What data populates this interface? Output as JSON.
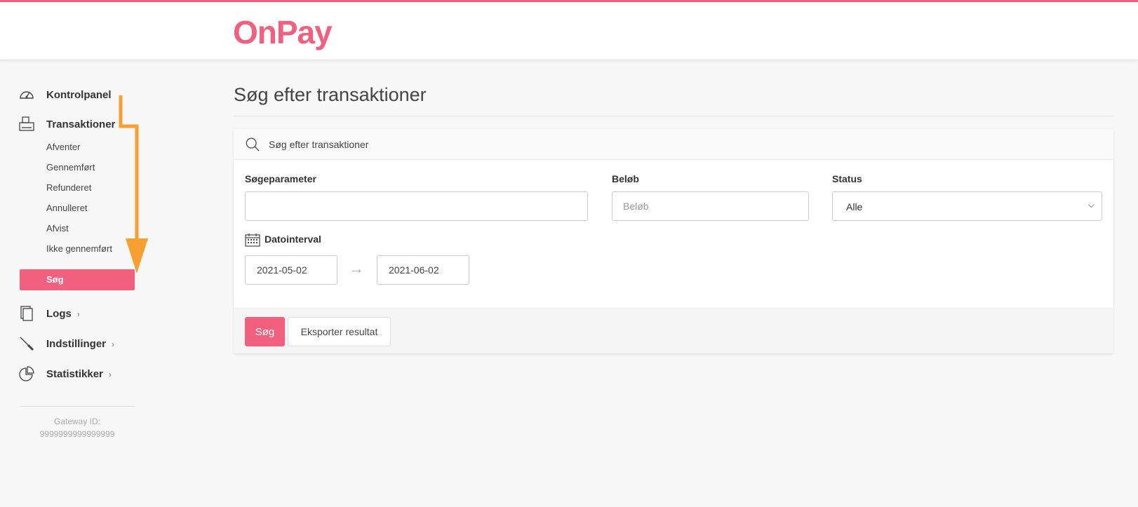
{
  "brand": {
    "logo_text": "OnPay",
    "accent_color": "#f2607f"
  },
  "sidebar": {
    "main_items": [
      {
        "label": "Kontrolpanel",
        "icon": "gauge-icon"
      },
      {
        "label": "Transaktioner",
        "icon": "printer-icon"
      }
    ],
    "sub_items": [
      {
        "label": "Afventer"
      },
      {
        "label": "Gennemført"
      },
      {
        "label": "Refunderet"
      },
      {
        "label": "Annulleret"
      },
      {
        "label": "Afvist"
      },
      {
        "label": "Ikke gennemført"
      }
    ],
    "active_item": {
      "label": "Søg"
    },
    "more_items": [
      {
        "label": "Logs",
        "icon": "documents-icon",
        "chevron": "›"
      },
      {
        "label": "Indstillinger",
        "icon": "screwdriver-icon",
        "chevron": "›"
      },
      {
        "label": "Statistikker",
        "icon": "pie-chart-icon",
        "chevron": "›"
      }
    ],
    "gateway_label": "Gateway ID:",
    "gateway_id": "9999999999999999"
  },
  "main": {
    "title": "Søg efter transaktioner",
    "panel": {
      "header_text": "Søg efter transaktioner",
      "search_param_label": "Søgeparameter",
      "search_param_value": "",
      "amount_label": "Beløb",
      "amount_placeholder": "Beløb",
      "status_label": "Status",
      "status_value": "Alle",
      "date_label": "Datointerval",
      "date_from": "2021-05-02",
      "date_to": "2021-06-02",
      "search_button": "Søg",
      "export_button": "Eksporter resultat"
    }
  },
  "annotation": {
    "arrow_color": "#f5a030"
  }
}
